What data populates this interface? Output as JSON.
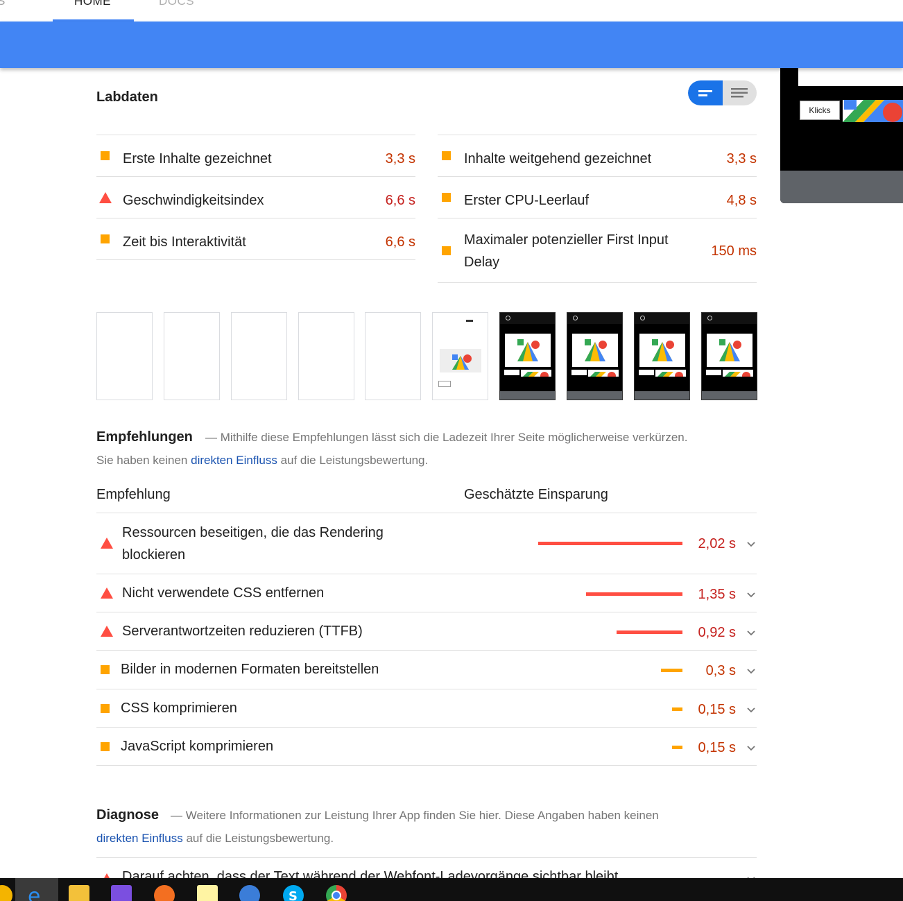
{
  "nav": {
    "tab_prev": "S",
    "tab_home": "HOME",
    "tab_docs": "DOCS"
  },
  "preview": {
    "button_label": "Klicks"
  },
  "labdaten": {
    "title": "Labdaten",
    "metrics_left": [
      {
        "label": "Erste Inhalte gezeichnet",
        "value": "3,3 s",
        "status": "average"
      },
      {
        "label": "Geschwindigkeitsindex",
        "value": "6,6 s",
        "status": "fail"
      },
      {
        "label": "Zeit bis Interaktivität",
        "value": "6,6 s",
        "status": "average"
      }
    ],
    "metrics_right": [
      {
        "label": "Inhalte weitgehend gezeichnet",
        "value": "3,3 s",
        "status": "average"
      },
      {
        "label": "Erster CPU-Leerlauf",
        "value": "4,8 s",
        "status": "average"
      },
      {
        "label_line1": "Maximaler potenzieller First Input",
        "label_line2": "Delay",
        "value": "150 ms",
        "status": "average"
      }
    ]
  },
  "empfehlungen": {
    "title": "Empfehlungen",
    "desc_1": "— Mithilfe diese Empfehlungen lässt sich die Ladezeit Ihrer Seite möglicherweise verkürzen.",
    "desc_2_pre": "Sie haben keinen ",
    "desc_link": "direkten Einfluss",
    "desc_2_post": " auf die Leistungsbewertung.",
    "col_left": "Empfehlung",
    "col_right": "Geschätzte Einsparung",
    "items": [
      {
        "label_line1": "Ressourcen beseitigen, die das Rendering",
        "label_line2": "blockieren",
        "value": "2,02 s",
        "status": "fail",
        "savings_s": 2.02
      },
      {
        "label_line1": "Nicht verwendete CSS entfernen",
        "value": "1,35 s",
        "status": "fail",
        "savings_s": 1.35
      },
      {
        "label_line1": "Serverantwortzeiten reduzieren (TTFB)",
        "value": "0,92 s",
        "status": "fail",
        "savings_s": 0.92
      },
      {
        "label_line1": "Bilder in modernen Formaten bereitstellen",
        "value": "0,3 s",
        "status": "average",
        "savings_s": 0.3
      },
      {
        "label_line1": "CSS komprimieren",
        "value": "0,15 s",
        "status": "average",
        "savings_s": 0.15
      },
      {
        "label_line1": "JavaScript komprimieren",
        "value": "0,15 s",
        "status": "average",
        "savings_s": 0.15
      }
    ]
  },
  "diagnose": {
    "title": "Diagnose",
    "desc_1": "— Weitere Informationen zur Leistung Ihrer App finden Sie hier. Diese Angaben haben keinen",
    "desc_link": "direkten Einfluss",
    "desc_2_post": " auf die Leistungsbewertung.",
    "first_item": "Darauf achten, dass der Text während der Webfont-Ladevorgänge sichtbar bleibt"
  },
  "colors": {
    "accent": "#4285f4",
    "fail": "#ff4e42",
    "average": "#ffa400",
    "fail_text": "#c5221f",
    "average_text": "#c33300"
  }
}
